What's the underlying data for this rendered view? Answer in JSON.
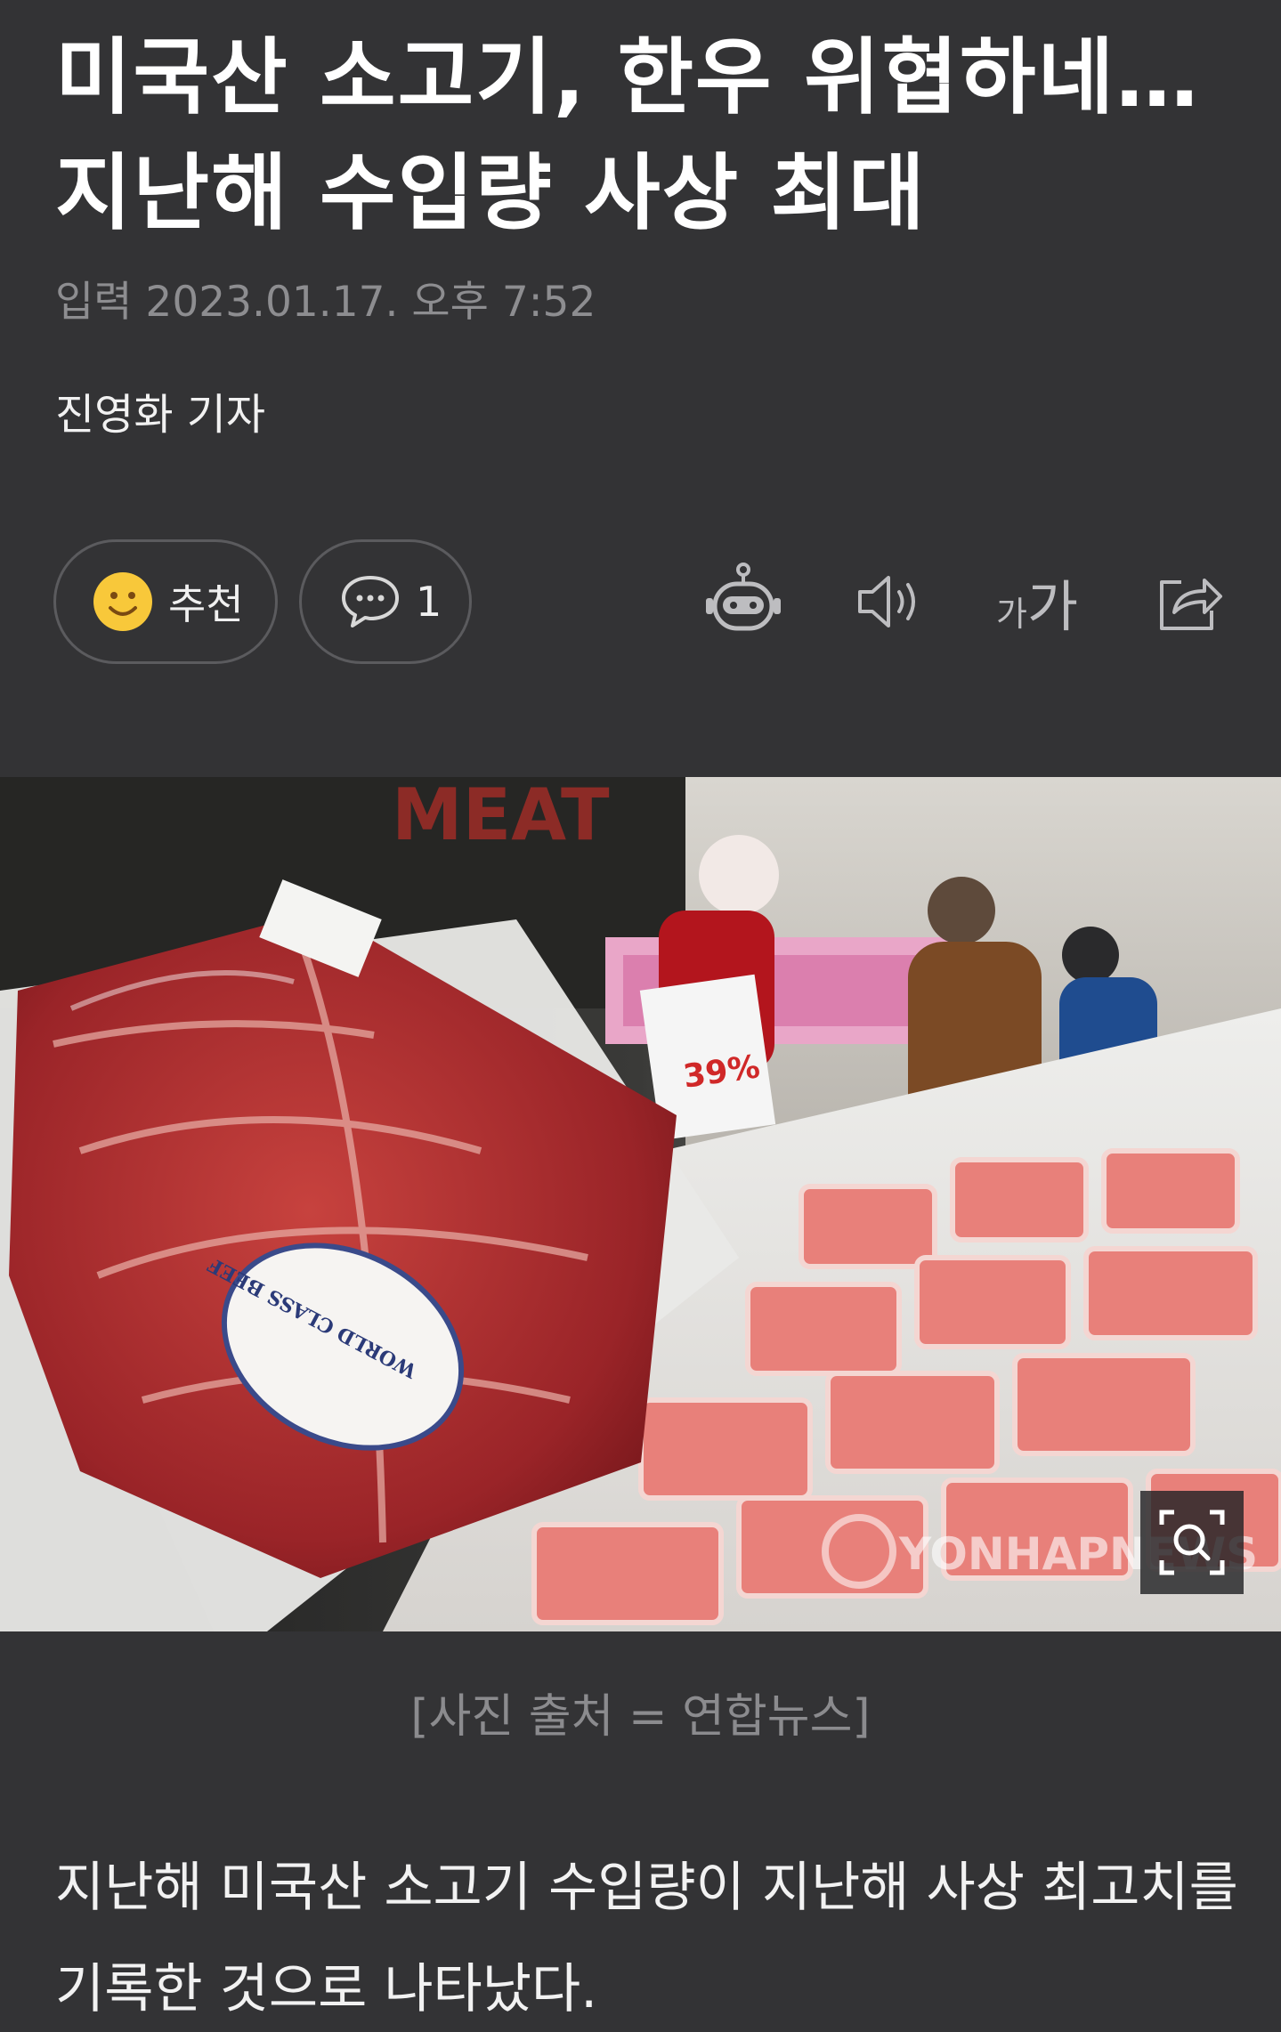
{
  "article": {
    "headline": "미국산 소고기, 한우 위협하네… 지난해 수입량 사상 최대",
    "published": "입력 2023.01.17. 오후 7:52",
    "reporter": "진영화 기자",
    "body": "지난해 미국산 소고기 수입량이 지난해 사상 최고치를 기록한 것으로 나타났다."
  },
  "actions": {
    "like_label": "추천",
    "comment_count": "1",
    "font_small": "가",
    "font_large": "가"
  },
  "icons": {
    "like": "smiley-face-icon",
    "comment": "speech-bubble-icon",
    "robot": "robot-summary-icon",
    "audio": "speaker-icon",
    "font": "font-size-icon",
    "share": "share-icon",
    "zoom": "zoom-magnifier-icon"
  },
  "photo": {
    "sign_text": "MEAT",
    "watermark": "YONHAPNEWS",
    "price_tag": "39%",
    "sticker_text": "WORLD CLASS BEEF",
    "caption": "[사진 출처 = 연합뉴스]"
  },
  "colors": {
    "background": "#333335",
    "headline": "#ffffff",
    "meta": "#8d8d90",
    "smiley": "#f8c83a"
  }
}
